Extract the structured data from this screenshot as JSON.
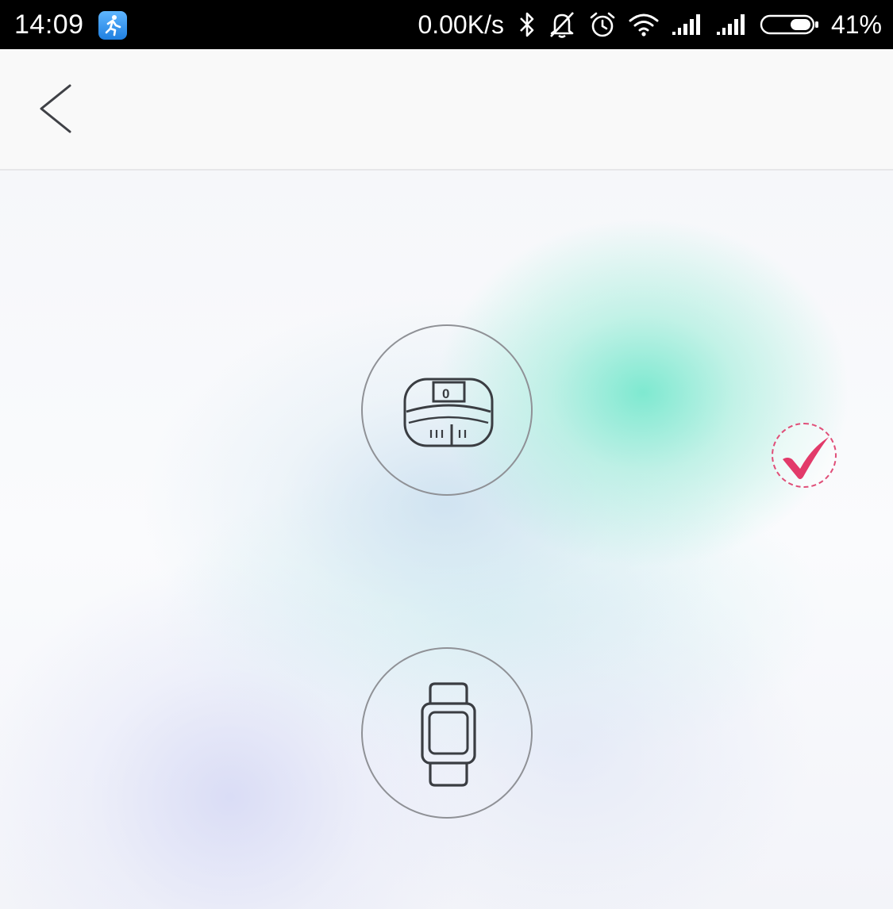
{
  "status_bar": {
    "time": "14:09",
    "network_speed": "0.00K/s",
    "battery_percent": "41%",
    "battery_level": 0.41,
    "icons": [
      "app-running-icon",
      "bluetooth-icon",
      "notifications-off-icon",
      "alarm-icon",
      "wifi-icon",
      "signal-icon",
      "signal-icon",
      "battery-icon"
    ]
  },
  "header": {
    "back_icon": "chevron-left-icon"
  },
  "devices": [
    {
      "name": "band",
      "icon": "fitness-band-icon",
      "band_digit": "0",
      "selected": true
    },
    {
      "name": "watch",
      "icon": "smartwatch-icon",
      "selected": false
    }
  ],
  "selection": {
    "icon": "checkmark-icon",
    "color": "#e23a6a"
  },
  "colors": {
    "status_bar_bg": "#000000",
    "header_bg": "#f9f9f9",
    "accent_glow": "#78e8ce",
    "circle_stroke": "#8f9196",
    "icon_stroke": "#3a3d42"
  }
}
